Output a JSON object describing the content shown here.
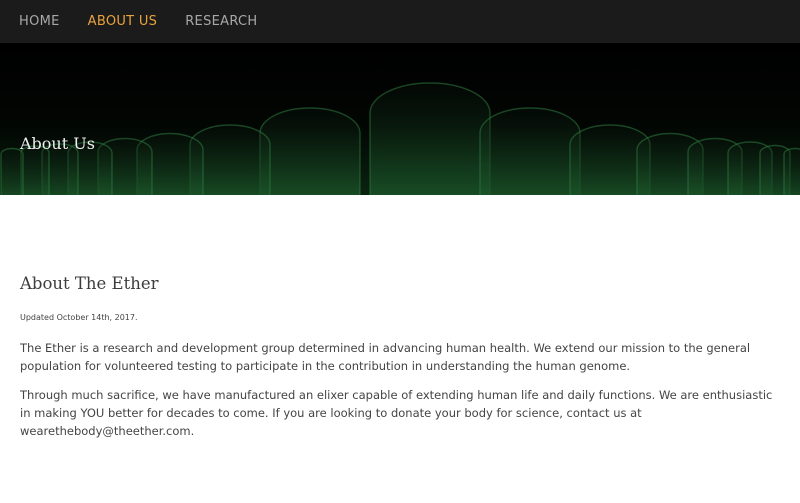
{
  "nav": {
    "items": [
      {
        "label": "HOME",
        "active": false
      },
      {
        "label": "ABOUT US",
        "active": true
      },
      {
        "label": "RESEARCH",
        "active": false
      }
    ],
    "colors": {
      "background": "#1b1b1b",
      "link": "#a8a8a8",
      "active": "#e8a33d"
    }
  },
  "hero": {
    "title": "About Us",
    "image": "test-tubes-green-glow"
  },
  "main": {
    "heading": "About The Ether",
    "updated": "Updated October 14th, 2017.",
    "paragraphs": [
      "The Ether is a research and development group determined in advancing human health. We extend our mission to the general population for volunteered testing to participate in the contribution in understanding the human genome.",
      "Through much sacrifice, we have manufactured an elixer capable of extending human life and daily functions. We are enthusiastic in making YOU better for decades to come. If you are looking to donate your body for science, contact us at wearethebody@theether.com."
    ]
  }
}
